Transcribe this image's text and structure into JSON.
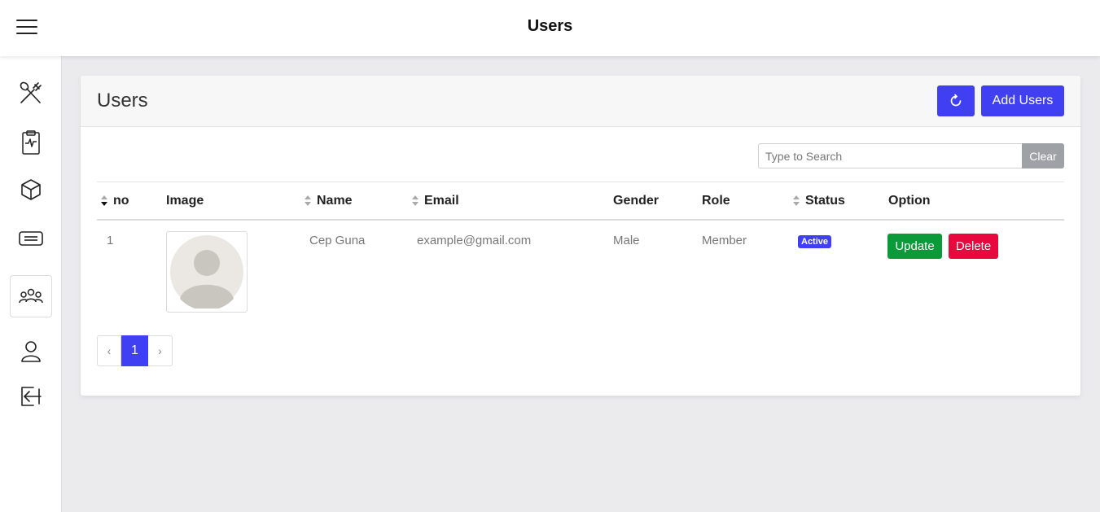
{
  "topbar": {
    "title": "Users",
    "menu_icon": "hamburger-menu-icon"
  },
  "sidebar": {
    "items": [
      {
        "icon": "utensils-icon",
        "active": false
      },
      {
        "icon": "clipboard-icon",
        "active": false
      },
      {
        "icon": "cube-icon",
        "active": false
      },
      {
        "icon": "card-icon",
        "active": false
      },
      {
        "icon": "users-icon",
        "active": true
      },
      {
        "icon": "user-icon",
        "active": false
      },
      {
        "icon": "logout-icon",
        "active": false
      }
    ]
  },
  "card": {
    "title": "Users",
    "refresh_icon": "refresh-icon",
    "add_label": "Add Users"
  },
  "search": {
    "placeholder": "Type to Search",
    "value": "",
    "clear_label": "Clear"
  },
  "table": {
    "columns": [
      {
        "label": "no",
        "sortable": true,
        "sort": "desc"
      },
      {
        "label": "Image",
        "sortable": false
      },
      {
        "label": "Name",
        "sortable": true
      },
      {
        "label": "Email",
        "sortable": true
      },
      {
        "label": "Gender",
        "sortable": false
      },
      {
        "label": "Role",
        "sortable": false
      },
      {
        "label": "Status",
        "sortable": true
      },
      {
        "label": "Option",
        "sortable": false
      }
    ],
    "rows": [
      {
        "no": "1",
        "image": "avatar-placeholder-icon",
        "name": "Cep Guna",
        "email": "example@gmail.com",
        "gender": "Male",
        "role": "Member",
        "status": "Active",
        "update_label": "Update",
        "delete_label": "Delete"
      }
    ]
  },
  "pagination": {
    "prev": "‹",
    "current": "1",
    "next": "›"
  },
  "colors": {
    "primary": "#4040f2",
    "success": "#0b9a3a",
    "danger": "#e8083e",
    "muted": "#9ea1a6"
  }
}
